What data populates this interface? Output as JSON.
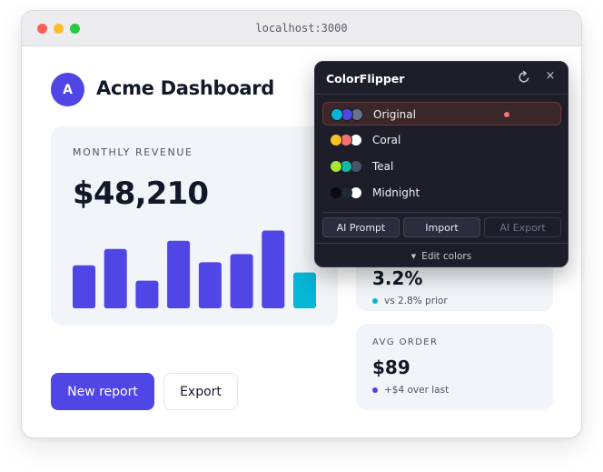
{
  "browser": {
    "url": "localhost:3000"
  },
  "dashboard": {
    "avatar_initial": "A",
    "title": "Acme Dashboard",
    "revenue": {
      "label": "MONTHLY REVENUE",
      "value": "$48,210"
    },
    "conversion": {
      "value": "3.2%",
      "subtext": "vs 2.8% prior",
      "dot_color": "#06b6d4"
    },
    "avg_order": {
      "label": "AVG ORDER",
      "value": "$89",
      "subtext": "+$4 over last",
      "dot_color": "#4f46e5"
    },
    "buttons": {
      "new_report": "New report",
      "export": "Export"
    }
  },
  "chart_data": {
    "type": "bar",
    "values": [
      42,
      58,
      27,
      66,
      45,
      53,
      76,
      35
    ],
    "highlight_index": 7,
    "colors": {
      "bar": "#4f46e5",
      "highlight": "#06b6d4"
    }
  },
  "colorflipper": {
    "title": "ColorFlipper",
    "close_glyph": "×",
    "themes": [
      {
        "name": "Original",
        "swatches": [
          "#06b6d4",
          "#4f46e5",
          "#64748b"
        ],
        "active": true
      },
      {
        "name": "Coral",
        "swatches": [
          "#fbbf24",
          "#f87171",
          "#ffffff"
        ],
        "active": false
      },
      {
        "name": "Teal",
        "swatches": [
          "#a3e635",
          "#14b8a6",
          "#475569"
        ],
        "active": false
      },
      {
        "name": "Midnight",
        "swatches": [
          "#0b0b12",
          "#1f2937",
          "#ffffff"
        ],
        "active": false
      }
    ],
    "buttons": {
      "ai_prompt": "AI Prompt",
      "import": "Import",
      "ai_export": "AI Export"
    },
    "footer": {
      "caret": "▼",
      "label": "Edit colors"
    }
  }
}
